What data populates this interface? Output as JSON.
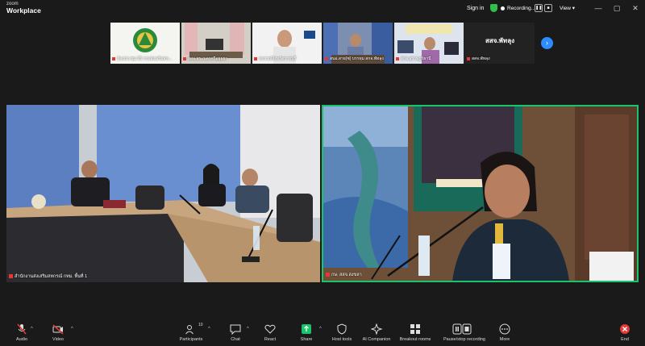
{
  "app": {
    "brand_top": "zoom",
    "brand_name": "Workplace"
  },
  "topbar": {
    "signin": "Sign in",
    "recording": "Recording...",
    "pause_glyph": "❚❚",
    "stop_glyph": "■",
    "view": "View",
    "view_caret": "▾",
    "minimize": "—",
    "maximize": "▢",
    "close": "✕"
  },
  "gallery": {
    "tiles": [
      {
        "name": "ห้องประชุม 05 กรมส่งเสริมสห..."
      },
      {
        "name": "สสจ.พระนครศรีอยุธยา"
      },
      {
        "name": "สหกรณ์จังหวัดราชบุรี"
      },
      {
        "name": "สนอ.สาย(ซ) บรรทุม สกจ.พัทลุง"
      },
      {
        "name": "สกจ.สุราษฎร์ธานี"
      },
      {
        "name": "สสจ.พัทลุง",
        "big": "สสจ.พัทลุง"
      }
    ],
    "next": "›"
  },
  "main": {
    "left_label": "สำนักงานส่งเสริมสหกรณ์ กทม. พื้นที่ 1",
    "right_label": "กษ. สสจ.สงขลา"
  },
  "toolbar": {
    "audio": "Audio",
    "video": "Video",
    "participants": "Participants",
    "participants_count": "10",
    "chat": "Chat",
    "react": "React",
    "share": "Share",
    "host_tools": "Host tools",
    "ai_companion": "AI Companion",
    "breakout": "Breakout rooms",
    "pause_recording": "Pause/stop recording",
    "more": "More",
    "end": "End",
    "caret": "^"
  },
  "colors": {
    "accent": "#2d8cff",
    "active_speaker": "#19c46b",
    "recording": "#2fbf4a",
    "alert": "#e33b3b",
    "share": "#19c46b"
  }
}
